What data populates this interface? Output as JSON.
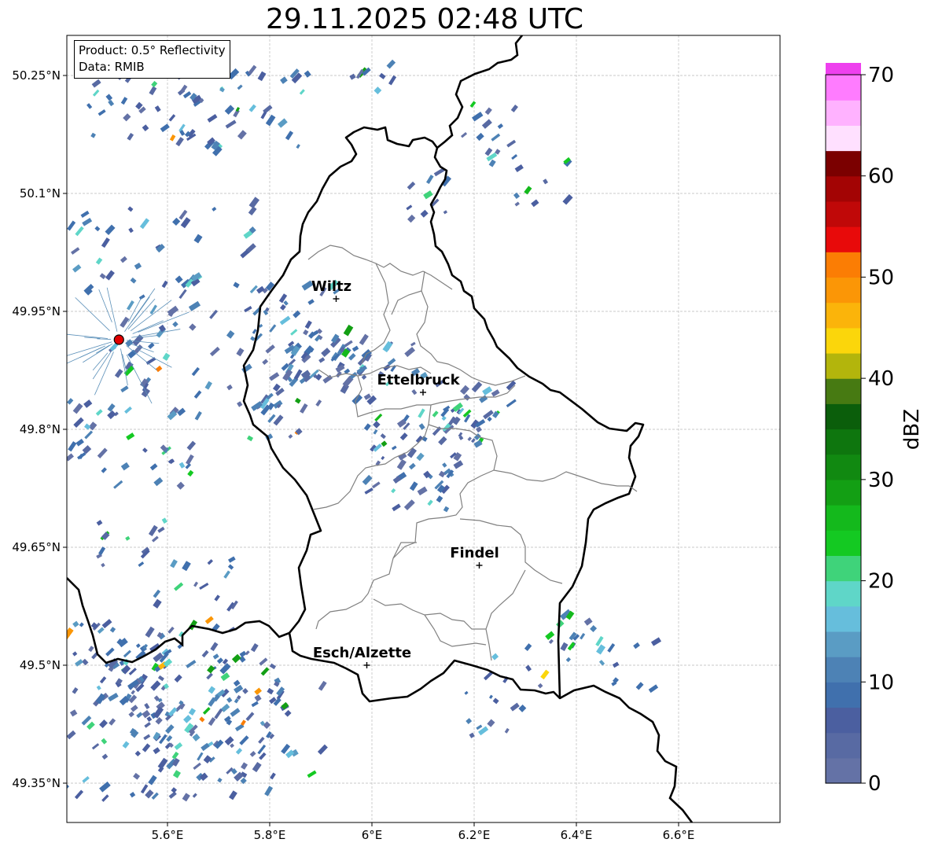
{
  "title": "29.11.2025 02:48 UTC",
  "info": {
    "product": "Product: 0.5° Reflectivity",
    "data": "Data: RMIB"
  },
  "map": {
    "lon_range": [
      5.4,
      6.8
    ],
    "lat_range": [
      49.3,
      50.3
    ],
    "lon_ticks": [
      "5.6°E",
      "5.8°E",
      "6°E",
      "6.2°E",
      "6.4°E",
      "6.6°E"
    ],
    "lat_ticks": [
      "50.25°N",
      "50.1°N",
      "49.95°N",
      "49.8°N",
      "49.65°N",
      "49.5°N",
      "49.35°N"
    ],
    "grid": true,
    "cities": [
      {
        "name": "Wiltz",
        "lon": 5.93,
        "lat": 49.966
      },
      {
        "name": "Ettelbruck",
        "lon": 6.1,
        "lat": 49.847
      },
      {
        "name": "Findel",
        "lon": 6.21,
        "lat": 49.627
      },
      {
        "name": "Esch/Alzette",
        "lon": 5.99,
        "lat": 49.5
      }
    ],
    "radar_site": {
      "lon": 5.505,
      "lat": 49.914
    }
  },
  "colorbar": {
    "label": "dBZ",
    "ticks": [
      "0",
      "10",
      "20",
      "30",
      "40",
      "50",
      "60",
      "70"
    ],
    "min": 0,
    "max": 70,
    "step": 2.5,
    "colors": [
      "#6472a6",
      "#586aa3",
      "#4b5fa0",
      "#4070ad",
      "#4d82b5",
      "#5a9cc4",
      "#66bedc",
      "#5fd6c8",
      "#3fd37a",
      "#14c922",
      "#14b91c",
      "#139f14",
      "#118911",
      "#0e760e",
      "#0b5e0b",
      "#477a12",
      "#b3b50c",
      "#fbd60b",
      "#fbb40a",
      "#fb9606",
      "#fb7d04",
      "#e80a0a",
      "#c00808",
      "#a30404",
      "#7b0000",
      "#ffe0ff",
      "#ffb2ff",
      "#ff7cff",
      "#ee40ee"
    ]
  }
}
